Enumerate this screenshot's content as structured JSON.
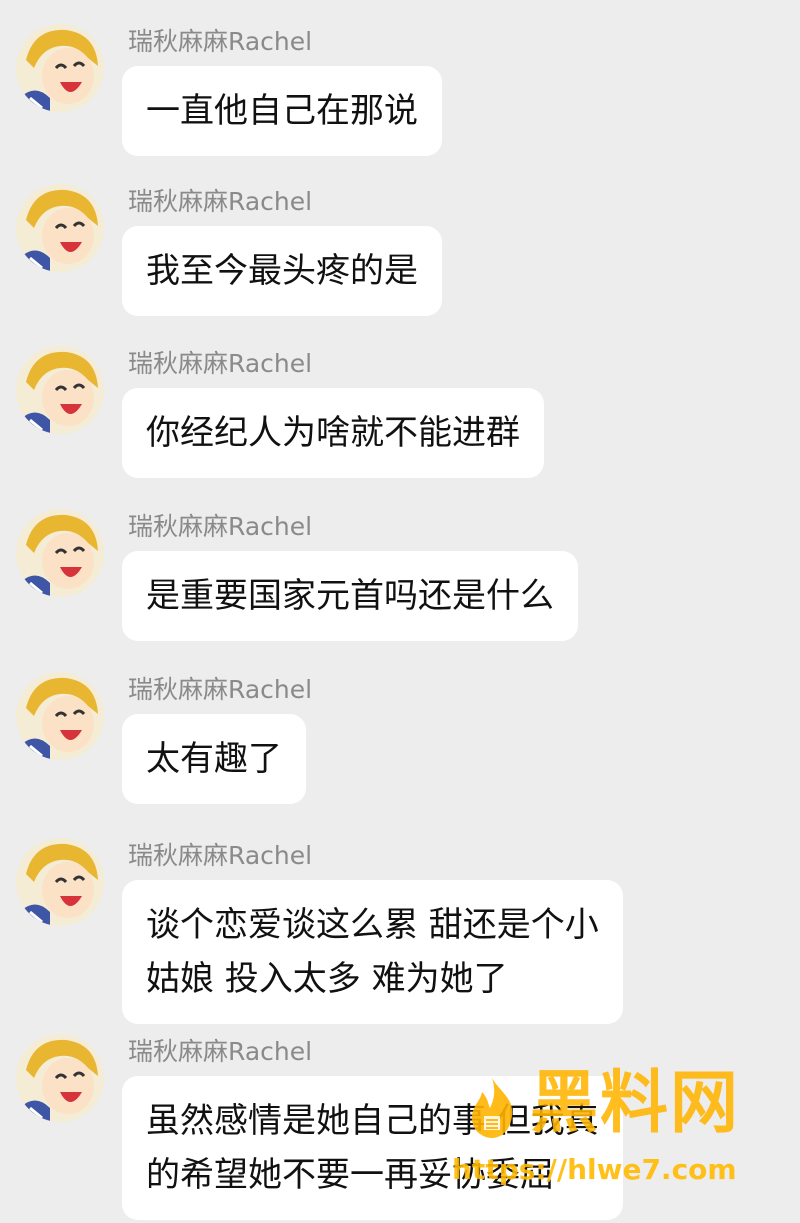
{
  "messages": [
    {
      "sender": "瑞秋麻麻Rachel",
      "text": "一直他自己在那说",
      "avatar_icon": "cartoon-girl-avatar"
    },
    {
      "sender": "瑞秋麻麻Rachel",
      "text": "我至今最头疼的是",
      "avatar_icon": "cartoon-girl-avatar"
    },
    {
      "sender": "瑞秋麻麻Rachel",
      "text": "你经纪人为啥就不能进群",
      "avatar_icon": "cartoon-girl-avatar"
    },
    {
      "sender": "瑞秋麻麻Rachel",
      "text": "是重要国家元首吗还是什么",
      "avatar_icon": "cartoon-girl-avatar"
    },
    {
      "sender": "瑞秋麻麻Rachel",
      "text": "太有趣了",
      "avatar_icon": "cartoon-girl-avatar"
    },
    {
      "sender": "瑞秋麻麻Rachel",
      "text": "谈个恋爱谈这么累 甜还是个小\n姑娘 投入太多 难为她了",
      "avatar_icon": "cartoon-girl-avatar"
    },
    {
      "sender": "瑞秋麻麻Rachel",
      "text": "虽然感情是她自己的事 但我真\n的希望她不要一再妥协委屈",
      "avatar_icon": "cartoon-girl-avatar"
    }
  ],
  "watermark": {
    "title": "黑料网",
    "url": "https://hlwe7.com",
    "icon": "flame-logo-icon",
    "color": "#ffb400"
  },
  "colors": {
    "background": "#ededed",
    "bubble": "#ffffff",
    "sender_text": "#8a8a8a",
    "message_text": "#111111"
  }
}
